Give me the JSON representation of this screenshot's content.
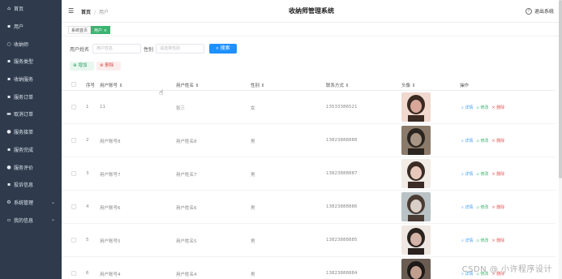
{
  "sidebar": {
    "items": [
      {
        "label": "首页",
        "icon": "home-icon"
      },
      {
        "label": "用户",
        "icon": "user-icon"
      },
      {
        "label": "收纳师",
        "icon": "user-icon"
      },
      {
        "label": "服务类型",
        "icon": "grid-icon"
      },
      {
        "label": "收纳服务",
        "icon": "grid-icon"
      },
      {
        "label": "服务订单",
        "icon": "grid-icon"
      },
      {
        "label": "取消订单",
        "icon": "chat-icon"
      },
      {
        "label": "服务接单",
        "icon": "bulb-icon"
      },
      {
        "label": "服务完成",
        "icon": "grid-icon"
      },
      {
        "label": "服务评价",
        "icon": "chat-icon"
      },
      {
        "label": "投诉信息",
        "icon": "grid-icon"
      },
      {
        "label": "系统管理",
        "icon": "gear-icon",
        "expandable": true
      },
      {
        "label": "我的信息",
        "icon": "grid-icon",
        "expandable": true
      }
    ]
  },
  "header": {
    "breadcrumb_home": "首页",
    "breadcrumb_current": "用户",
    "title": "收纳师管理系统",
    "logout": "退出系统"
  },
  "tags": {
    "home": "系统首页",
    "current": "用户 ×"
  },
  "search": {
    "name_label": "用户姓名",
    "name_placeholder": "用户姓名",
    "gender_label": "性别",
    "gender_placeholder": "请选择性别",
    "button": "搜索"
  },
  "actions": {
    "add": "增加",
    "delete": "删除"
  },
  "table": {
    "headers": {
      "index": "序号",
      "account": "用户账号 ⇕",
      "name": "用户姓名 ⇕",
      "gender": "性别 ⇕",
      "phone": "联系方式 ⇕",
      "avatar": "头像 ⇕",
      "ops": "操作"
    },
    "ops": {
      "view": "详情",
      "edit": "修改",
      "delete": "删除"
    },
    "rows": [
      {
        "index": "1",
        "account": "11",
        "name": "张三",
        "gender": "女",
        "phone": "13533386521"
      },
      {
        "index": "2",
        "account": "用户账号8",
        "name": "用户姓名8",
        "gender": "男",
        "phone": "13823888888"
      },
      {
        "index": "3",
        "account": "用户账号7",
        "name": "用户姓名7",
        "gender": "男",
        "phone": "13823888887"
      },
      {
        "index": "4",
        "account": "用户账号6",
        "name": "用户姓名6",
        "gender": "男",
        "phone": "13823888886"
      },
      {
        "index": "5",
        "account": "用户账号5",
        "name": "用户姓名5",
        "gender": "男",
        "phone": "13823888885"
      },
      {
        "index": "6",
        "account": "用户账号4",
        "name": "用户姓名4",
        "gender": "男",
        "phone": "13823888884"
      }
    ]
  },
  "watermark": "CSDN @ 小许程序设计",
  "colors": {
    "sidebar_bg": "#2f3b4c",
    "primary": "#1e90ff",
    "success": "#3cb371",
    "danger": "#e05a5a"
  }
}
